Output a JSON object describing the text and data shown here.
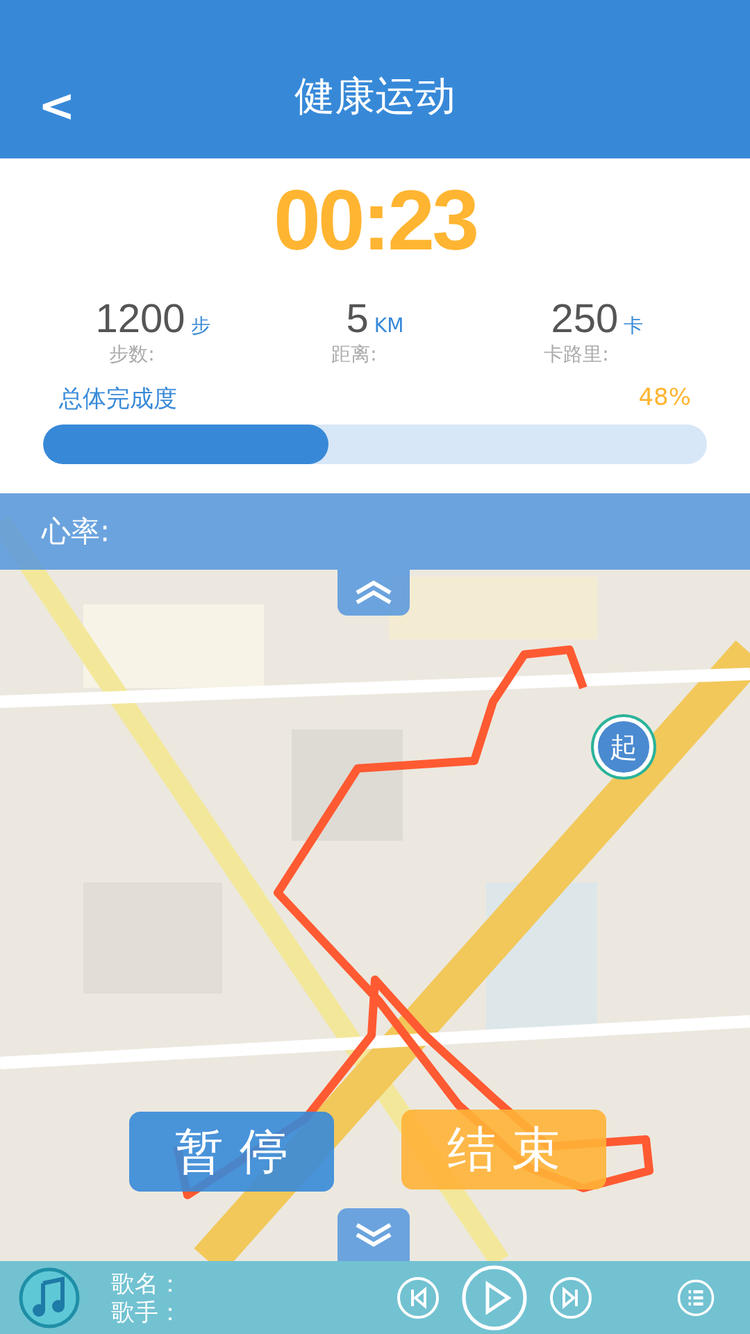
{
  "header": {
    "back": "<",
    "title": "健康运动"
  },
  "timer": "00:23",
  "stats": [
    {
      "value": "1200",
      "unit": "步",
      "label": "步数:"
    },
    {
      "value": "5",
      "unit": "KM",
      "label": "距离:"
    },
    {
      "value": "250",
      "unit": "卡",
      "label": "卡路里:"
    }
  ],
  "progress": {
    "label": "总体完成度",
    "reading": "48%",
    "level": 0.43
  },
  "heart_rate": {
    "label": "心率:"
  },
  "map": {
    "kind": "picture",
    "start_marker": "起"
  },
  "buttons": [
    {
      "kind": "pause",
      "label": "暂 停"
    },
    {
      "kind": "end",
      "label": "结 束"
    }
  ],
  "player": {
    "song_label": "歌名：",
    "artist_label": "歌手："
  }
}
